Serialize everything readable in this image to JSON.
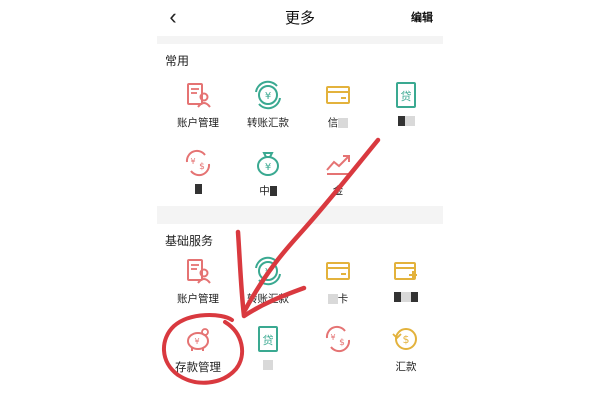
{
  "header": {
    "back_glyph": "‹",
    "title": "更多",
    "edit_label": "编辑"
  },
  "sections": [
    {
      "title": "常用",
      "items": [
        {
          "label": "账户管理",
          "icon": "account-management-icon"
        },
        {
          "label": "转账汇款",
          "icon": "transfer-icon"
        },
        {
          "label": "信",
          "icon": "card-icon"
        },
        {
          "label": "",
          "icon": "loan-icon"
        },
        {
          "label": "",
          "icon": "currency-exchange-icon"
        },
        {
          "label": "中",
          "icon": "money-bag-icon"
        },
        {
          "label": "金",
          "icon": "gold-chart-icon"
        }
      ]
    },
    {
      "title": "基础服务",
      "items": [
        {
          "label": "账户管理",
          "icon": "account-management-icon"
        },
        {
          "label": "转账汇款",
          "icon": "transfer-icon"
        },
        {
          "label": "卡",
          "icon": "card-icon"
        },
        {
          "label": "",
          "icon": "card-add-icon"
        },
        {
          "label": "存款管理",
          "icon": "piggy-bank-icon"
        },
        {
          "label": "",
          "icon": "loan-icon"
        },
        {
          "label": "",
          "icon": "currency-exchange-icon"
        },
        {
          "label": "汇款",
          "icon": "remittance-icon"
        }
      ]
    }
  ],
  "colors": {
    "red": "#e57373",
    "teal": "#3aa991",
    "gold": "#e3b23c",
    "annotation": "#d9393f"
  }
}
